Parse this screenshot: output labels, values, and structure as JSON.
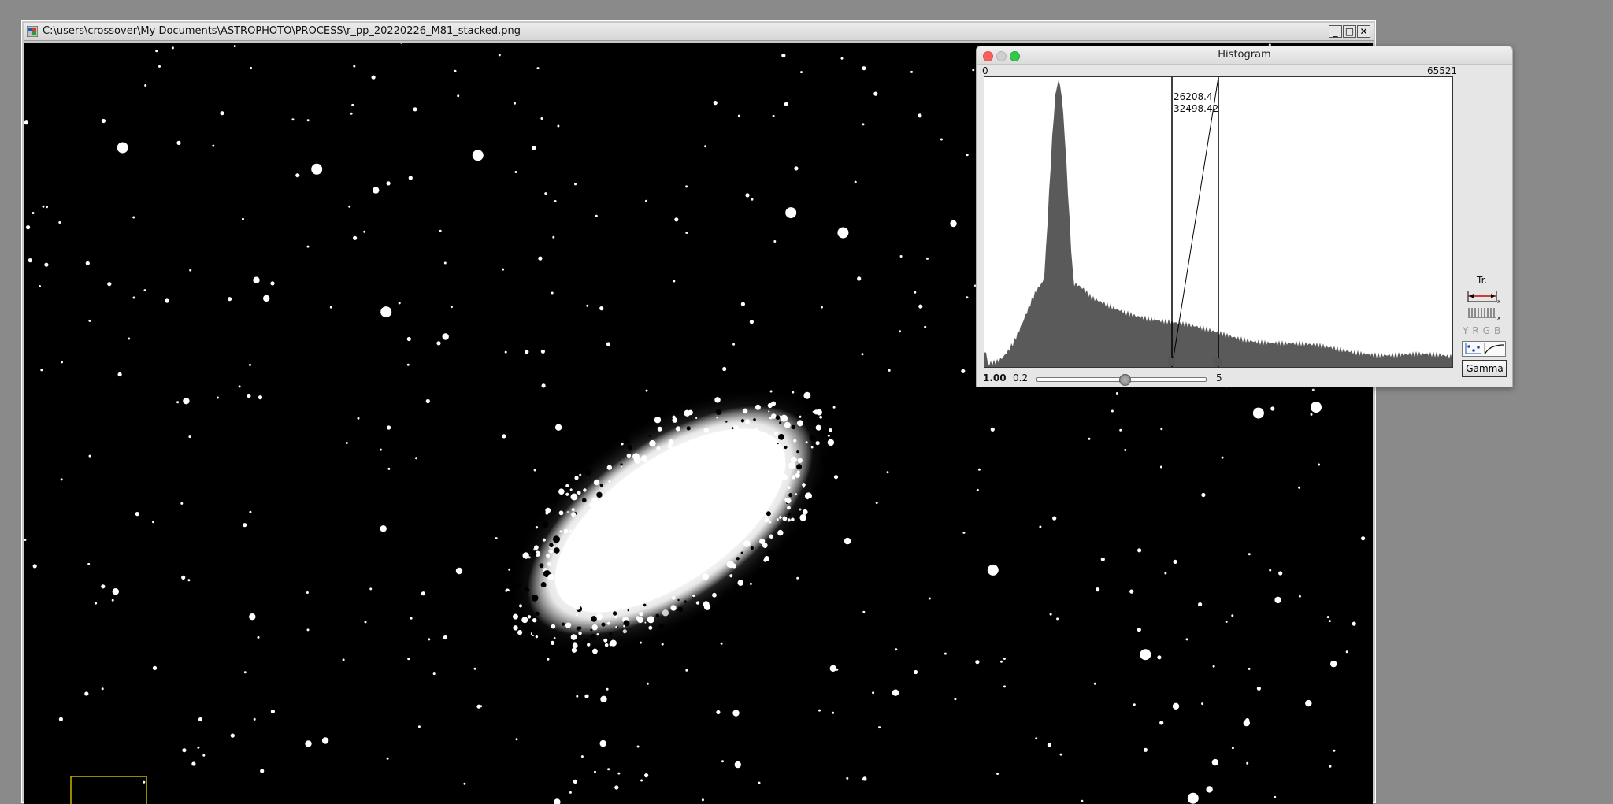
{
  "image_window": {
    "title": "C:\\users\\crossover\\My Documents\\ASTROPHOTO\\PROCESS\\r_pp_20220226_M81_stacked.png",
    "minimize_label": "_",
    "maximize_label": "□",
    "close_label": "✕",
    "app_icon": "iris-app-icon"
  },
  "histogram": {
    "title": "Histogram",
    "min_label": "0",
    "max_label": "65521",
    "low_threshold": "26208.4",
    "high_threshold": "32498.42",
    "gamma_value": "1.00",
    "gamma_min": "0.2",
    "gamma_max": "5",
    "gamma_fraction": 0.52,
    "tr_label": "Tr.",
    "channel_labels": "YRGB",
    "gamma_button": "Gamma",
    "icons": [
      "close-traffic-light",
      "minimize-traffic-light",
      "zoom-traffic-light",
      "stretch-icon",
      "levels-icon",
      "curve-icon"
    ],
    "colors": {
      "fill": "#5a5a5a",
      "close": "#fc605c",
      "zoom": "#34c84a",
      "selection_box": "#c8b400"
    }
  }
}
